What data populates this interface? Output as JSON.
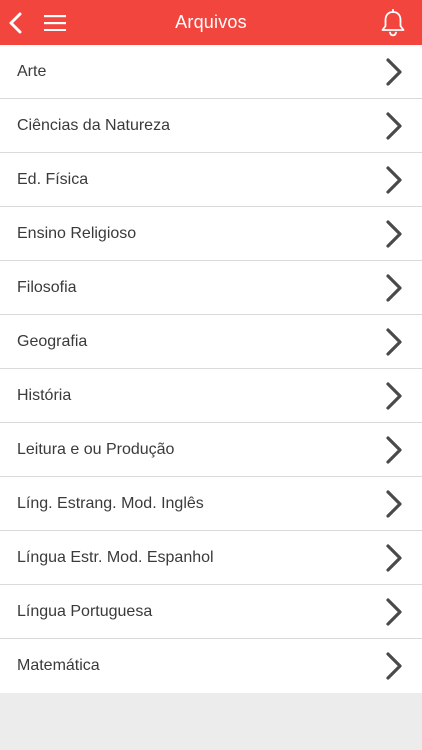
{
  "header": {
    "title": "Arquivos",
    "back_icon": "chevron-left-icon",
    "menu_icon": "hamburger-menu-icon",
    "notification_icon": "bell-icon",
    "background_color": "#f2453d"
  },
  "list": {
    "items": [
      {
        "label": "Arte"
      },
      {
        "label": "Ciências da Natureza"
      },
      {
        "label": "Ed. Física"
      },
      {
        "label": "Ensino Religioso"
      },
      {
        "label": "Filosofia"
      },
      {
        "label": "Geografia"
      },
      {
        "label": "História"
      },
      {
        "label": "Leitura e ou Produção"
      },
      {
        "label": "Líng. Estrang. Mod. Inglês"
      },
      {
        "label": "Língua Estr. Mod. Espanhol"
      },
      {
        "label": "Língua Portuguesa"
      },
      {
        "label": "Matemática"
      }
    ],
    "item_icon": "chevron-right-icon"
  }
}
